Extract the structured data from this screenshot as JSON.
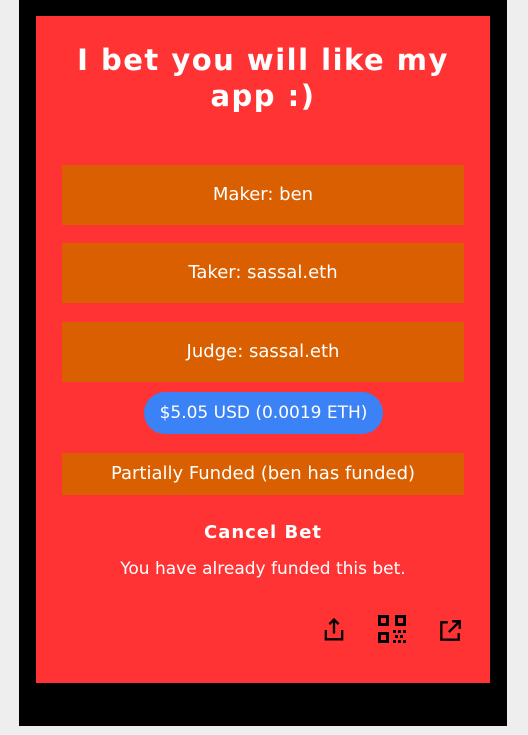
{
  "page": {
    "title": "I bet you will like my app :)"
  },
  "participants": {
    "maker": "Maker: ben",
    "taker": "Taker: sassal.eth",
    "judge": "Judge: sassal.eth"
  },
  "amount": {
    "label": "$5.05 USD (0.0019 ETH)"
  },
  "status": {
    "label": "Partially Funded (ben has funded)"
  },
  "actions": {
    "cancel_label": "Cancel Bet",
    "note": "You have already funded this bet."
  },
  "toolbar": {
    "icons": [
      "share-icon",
      "qr-code-icon",
      "open-external-icon"
    ]
  },
  "colors": {
    "card": "#ff3333",
    "row": "#d95f00",
    "pill": "#3b82f6",
    "frame": "#000000",
    "page_bg": "#eeeeee"
  }
}
